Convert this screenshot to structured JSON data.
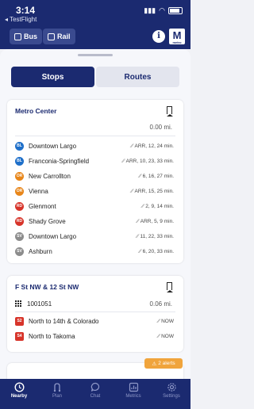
{
  "status": {
    "time": "3:14",
    "back_label": "◂ TestFlight"
  },
  "header": {
    "bus_label": "Bus",
    "rail_label": "Rail",
    "info_label": "i",
    "logo_letter": "M",
    "logo_sub": "metro"
  },
  "segmented": {
    "stops_label": "Stops",
    "routes_label": "Routes"
  },
  "stops": [
    {
      "name": "Metro Center",
      "distance": "0.00 mi.",
      "departures": [
        {
          "line": "BL",
          "color": "#1e6fc9",
          "destination": "Downtown Largo",
          "times": "ARR, 12, 24 min."
        },
        {
          "line": "BL",
          "color": "#1e6fc9",
          "destination": "Franconia-Springfield",
          "times": "ARR, 10, 23, 33 min."
        },
        {
          "line": "OR",
          "color": "#e8861a",
          "destination": "New Carrollton",
          "times": "6, 16, 27 min."
        },
        {
          "line": "OR",
          "color": "#e8861a",
          "destination": "Vienna",
          "times": "ARR, 15, 25 min."
        },
        {
          "line": "RD",
          "color": "#d7342a",
          "destination": "Glenmont",
          "times": "2, 9, 14 min."
        },
        {
          "line": "RD",
          "color": "#d7342a",
          "destination": "Shady Grove",
          "times": "ARR, 5, 9 min."
        },
        {
          "line": "SV",
          "color": "#8c8c8c",
          "destination": "Downtown Largo",
          "times": "11, 22, 33 min."
        },
        {
          "line": "SV",
          "color": "#8c8c8c",
          "destination": "Ashburn",
          "times": "6, 20, 33 min."
        }
      ]
    },
    {
      "name": "F St NW & 12 St NW",
      "stop_id": "1001051",
      "distance": "0.06 mi.",
      "departures": [
        {
          "line": "S2",
          "destination": "North to 14th & Colorado",
          "times": "NOW"
        },
        {
          "line": "S4",
          "destination": "North to Takoma",
          "times": "NOW"
        }
      ]
    }
  ],
  "alerts": {
    "label": "2 alerts"
  },
  "tabs": [
    {
      "label": "Nearby",
      "icon": "clock-icon"
    },
    {
      "label": "Plan",
      "icon": "route-icon"
    },
    {
      "label": "Chat",
      "icon": "chat-icon"
    },
    {
      "label": "Metrics",
      "icon": "metrics-icon"
    },
    {
      "label": "Settings",
      "icon": "gear-icon"
    }
  ]
}
